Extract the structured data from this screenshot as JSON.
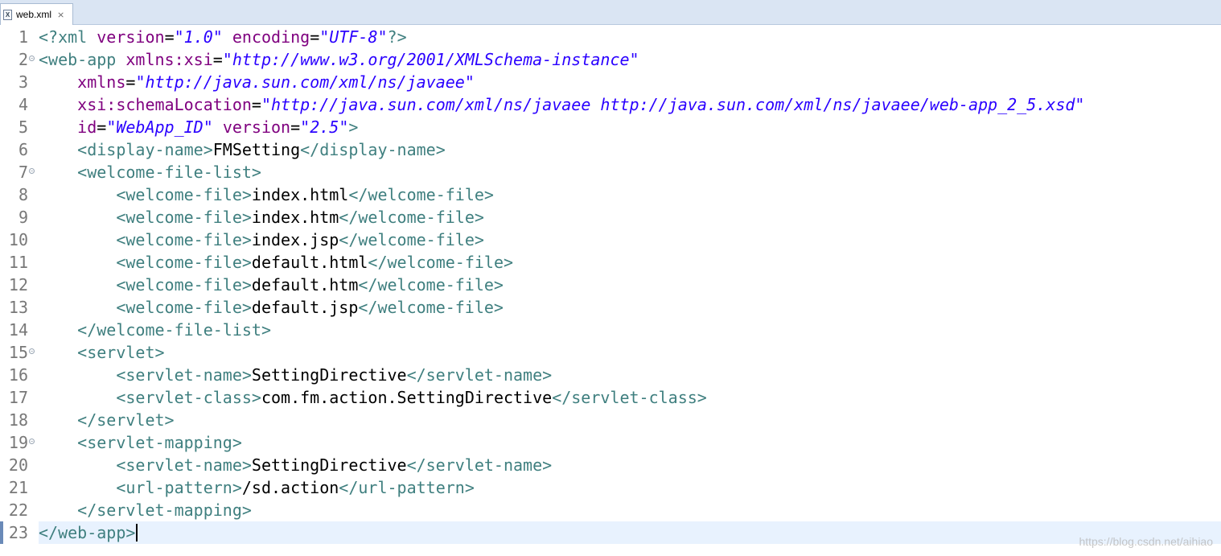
{
  "tab": {
    "title": "web.xml",
    "icon": "xml-file-icon",
    "close": "⨯"
  },
  "editor": {
    "lines": [
      {
        "n": "1",
        "fold": false,
        "segs": [
          [
            "p",
            "<?"
          ],
          [
            "t",
            "xml "
          ],
          [
            "a",
            "version"
          ],
          [
            "x",
            "="
          ],
          [
            "v",
            "\"1.0\""
          ],
          [
            "x",
            " "
          ],
          [
            "a",
            "encoding"
          ],
          [
            "x",
            "="
          ],
          [
            "v",
            "\"UTF-8\""
          ],
          [
            "p",
            "?>"
          ]
        ]
      },
      {
        "n": "2",
        "fold": true,
        "segs": [
          [
            "t",
            "<web-app "
          ],
          [
            "a",
            "xmlns:xsi"
          ],
          [
            "x",
            "="
          ],
          [
            "v",
            "\"http://www.w3.org/2001/XMLSchema-instance\""
          ]
        ]
      },
      {
        "n": "3",
        "fold": false,
        "segs": [
          [
            "x",
            "    "
          ],
          [
            "a",
            "xmlns"
          ],
          [
            "x",
            "="
          ],
          [
            "v",
            "\"http://java.sun.com/xml/ns/javaee\""
          ]
        ]
      },
      {
        "n": "4",
        "fold": false,
        "segs": [
          [
            "x",
            "    "
          ],
          [
            "a",
            "xsi:schemaLocation"
          ],
          [
            "x",
            "="
          ],
          [
            "v",
            "\"http://java.sun.com/xml/ns/javaee http://java.sun.com/xml/ns/javaee/web-app_2_5.xsd\""
          ]
        ]
      },
      {
        "n": "5",
        "fold": false,
        "segs": [
          [
            "x",
            "    "
          ],
          [
            "a",
            "id"
          ],
          [
            "x",
            "="
          ],
          [
            "v",
            "\"WebApp_ID\""
          ],
          [
            "x",
            " "
          ],
          [
            "a",
            "version"
          ],
          [
            "x",
            "="
          ],
          [
            "v",
            "\"2.5\""
          ],
          [
            "t",
            ">"
          ]
        ]
      },
      {
        "n": "6",
        "fold": false,
        "segs": [
          [
            "x",
            "    "
          ],
          [
            "t",
            "<display-name>"
          ],
          [
            "x",
            "FMSetting"
          ],
          [
            "t",
            "</display-name>"
          ]
        ]
      },
      {
        "n": "7",
        "fold": true,
        "segs": [
          [
            "x",
            "    "
          ],
          [
            "t",
            "<welcome-file-list>"
          ]
        ]
      },
      {
        "n": "8",
        "fold": false,
        "segs": [
          [
            "x",
            "        "
          ],
          [
            "t",
            "<welcome-file>"
          ],
          [
            "x",
            "index.html"
          ],
          [
            "t",
            "</welcome-file>"
          ]
        ]
      },
      {
        "n": "9",
        "fold": false,
        "segs": [
          [
            "x",
            "        "
          ],
          [
            "t",
            "<welcome-file>"
          ],
          [
            "x",
            "index.htm"
          ],
          [
            "t",
            "</welcome-file>"
          ]
        ]
      },
      {
        "n": "10",
        "fold": false,
        "segs": [
          [
            "x",
            "        "
          ],
          [
            "t",
            "<welcome-file>"
          ],
          [
            "x",
            "index.jsp"
          ],
          [
            "t",
            "</welcome-file>"
          ]
        ]
      },
      {
        "n": "11",
        "fold": false,
        "segs": [
          [
            "x",
            "        "
          ],
          [
            "t",
            "<welcome-file>"
          ],
          [
            "x",
            "default.html"
          ],
          [
            "t",
            "</welcome-file>"
          ]
        ]
      },
      {
        "n": "12",
        "fold": false,
        "segs": [
          [
            "x",
            "        "
          ],
          [
            "t",
            "<welcome-file>"
          ],
          [
            "x",
            "default.htm"
          ],
          [
            "t",
            "</welcome-file>"
          ]
        ]
      },
      {
        "n": "13",
        "fold": false,
        "segs": [
          [
            "x",
            "        "
          ],
          [
            "t",
            "<welcome-file>"
          ],
          [
            "x",
            "default.jsp"
          ],
          [
            "t",
            "</welcome-file>"
          ]
        ]
      },
      {
        "n": "14",
        "fold": false,
        "segs": [
          [
            "x",
            "    "
          ],
          [
            "t",
            "</welcome-file-list>"
          ]
        ]
      },
      {
        "n": "15",
        "fold": true,
        "segs": [
          [
            "x",
            "    "
          ],
          [
            "t",
            "<servlet>"
          ]
        ]
      },
      {
        "n": "16",
        "fold": false,
        "segs": [
          [
            "x",
            "        "
          ],
          [
            "t",
            "<servlet-name>"
          ],
          [
            "x",
            "SettingDirective"
          ],
          [
            "t",
            "</servlet-name>"
          ]
        ]
      },
      {
        "n": "17",
        "fold": false,
        "segs": [
          [
            "x",
            "        "
          ],
          [
            "t",
            "<servlet-class>"
          ],
          [
            "x",
            "com.fm.action.SettingDirective"
          ],
          [
            "t",
            "</servlet-class>"
          ]
        ]
      },
      {
        "n": "18",
        "fold": false,
        "segs": [
          [
            "x",
            "    "
          ],
          [
            "t",
            "</servlet>"
          ]
        ]
      },
      {
        "n": "19",
        "fold": true,
        "segs": [
          [
            "x",
            "    "
          ],
          [
            "t",
            "<servlet-mapping>"
          ]
        ]
      },
      {
        "n": "20",
        "fold": false,
        "segs": [
          [
            "x",
            "        "
          ],
          [
            "t",
            "<servlet-name>"
          ],
          [
            "x",
            "SettingDirective"
          ],
          [
            "t",
            "</servlet-name>"
          ]
        ]
      },
      {
        "n": "21",
        "fold": false,
        "segs": [
          [
            "x",
            "        "
          ],
          [
            "t",
            "<url-pattern>"
          ],
          [
            "x",
            "/sd.action"
          ],
          [
            "t",
            "</url-pattern>"
          ]
        ]
      },
      {
        "n": "22",
        "fold": false,
        "segs": [
          [
            "x",
            "    "
          ],
          [
            "t",
            "</servlet-mapping>"
          ]
        ]
      },
      {
        "n": "23",
        "fold": false,
        "current": true,
        "segs": [
          [
            "t",
            "</web-app>"
          ]
        ]
      }
    ]
  },
  "watermark": "https://blog.csdn.net/aihiao"
}
